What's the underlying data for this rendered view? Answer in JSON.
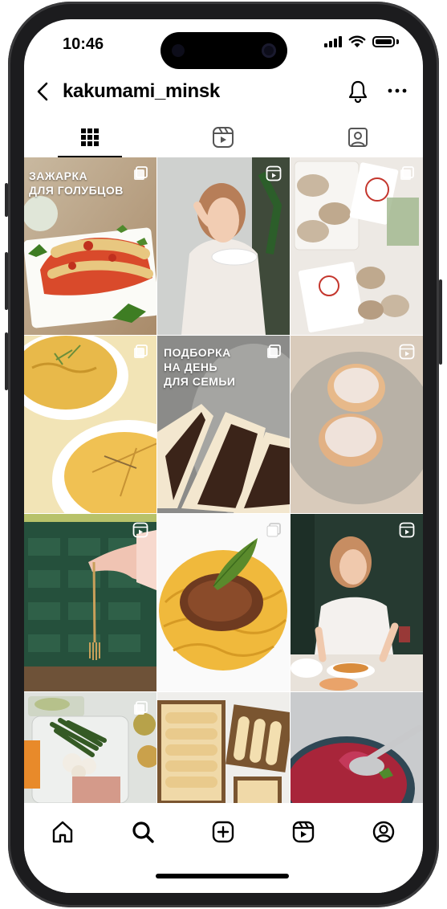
{
  "status_bar": {
    "time": "10:46"
  },
  "profile": {
    "username": "kakumami_minsk"
  },
  "tabs": [
    {
      "name": "posts-grid-icon",
      "active": true
    },
    {
      "name": "reels-icon",
      "active": false
    },
    {
      "name": "tagged-icon",
      "active": false
    }
  ],
  "posts": [
    {
      "overlay": "ЗАЖАРКА\nДЛЯ ГОЛУБЦОВ",
      "badge": "carousel-icon",
      "scene": "cabbage rolls with tomato sauce"
    },
    {
      "overlay": "",
      "badge": "reels-icon",
      "scene": "woman eating from a bowl"
    },
    {
      "overlay": "",
      "badge": "carousel-icon",
      "scene": "frozen cutlets in branded packages"
    },
    {
      "overlay": "",
      "badge": "carousel-icon",
      "scene": "omelette on plates"
    },
    {
      "overlay": "ПОДБОРКА\nНА ДЕНЬ\nДЛЯ СЕМЬИ",
      "badge": "carousel-icon",
      "scene": "chocolate filled bread slices"
    },
    {
      "overlay": "",
      "badge": "reels-icon",
      "scene": "two syrniki on a plate"
    },
    {
      "overlay": "",
      "badge": "reels-icon",
      "scene": "hand holding a fork"
    },
    {
      "overlay": "",
      "badge": "carousel-icon",
      "scene": "spaghetti bolognese with basil"
    },
    {
      "overlay": "",
      "badge": "reels-icon",
      "scene": "woman eating at a table"
    },
    {
      "overlay": "",
      "badge": "carousel-icon",
      "scene": "meal prep containers"
    },
    {
      "overlay": "",
      "badge": "",
      "scene": "crepes in boxes"
    },
    {
      "overlay": "",
      "badge": "",
      "scene": "borscht with ladle"
    }
  ],
  "bottom_nav": [
    {
      "name": "home-icon"
    },
    {
      "name": "search-icon",
      "active": true
    },
    {
      "name": "create-post-icon"
    },
    {
      "name": "reels-icon"
    },
    {
      "name": "profile-icon"
    }
  ]
}
